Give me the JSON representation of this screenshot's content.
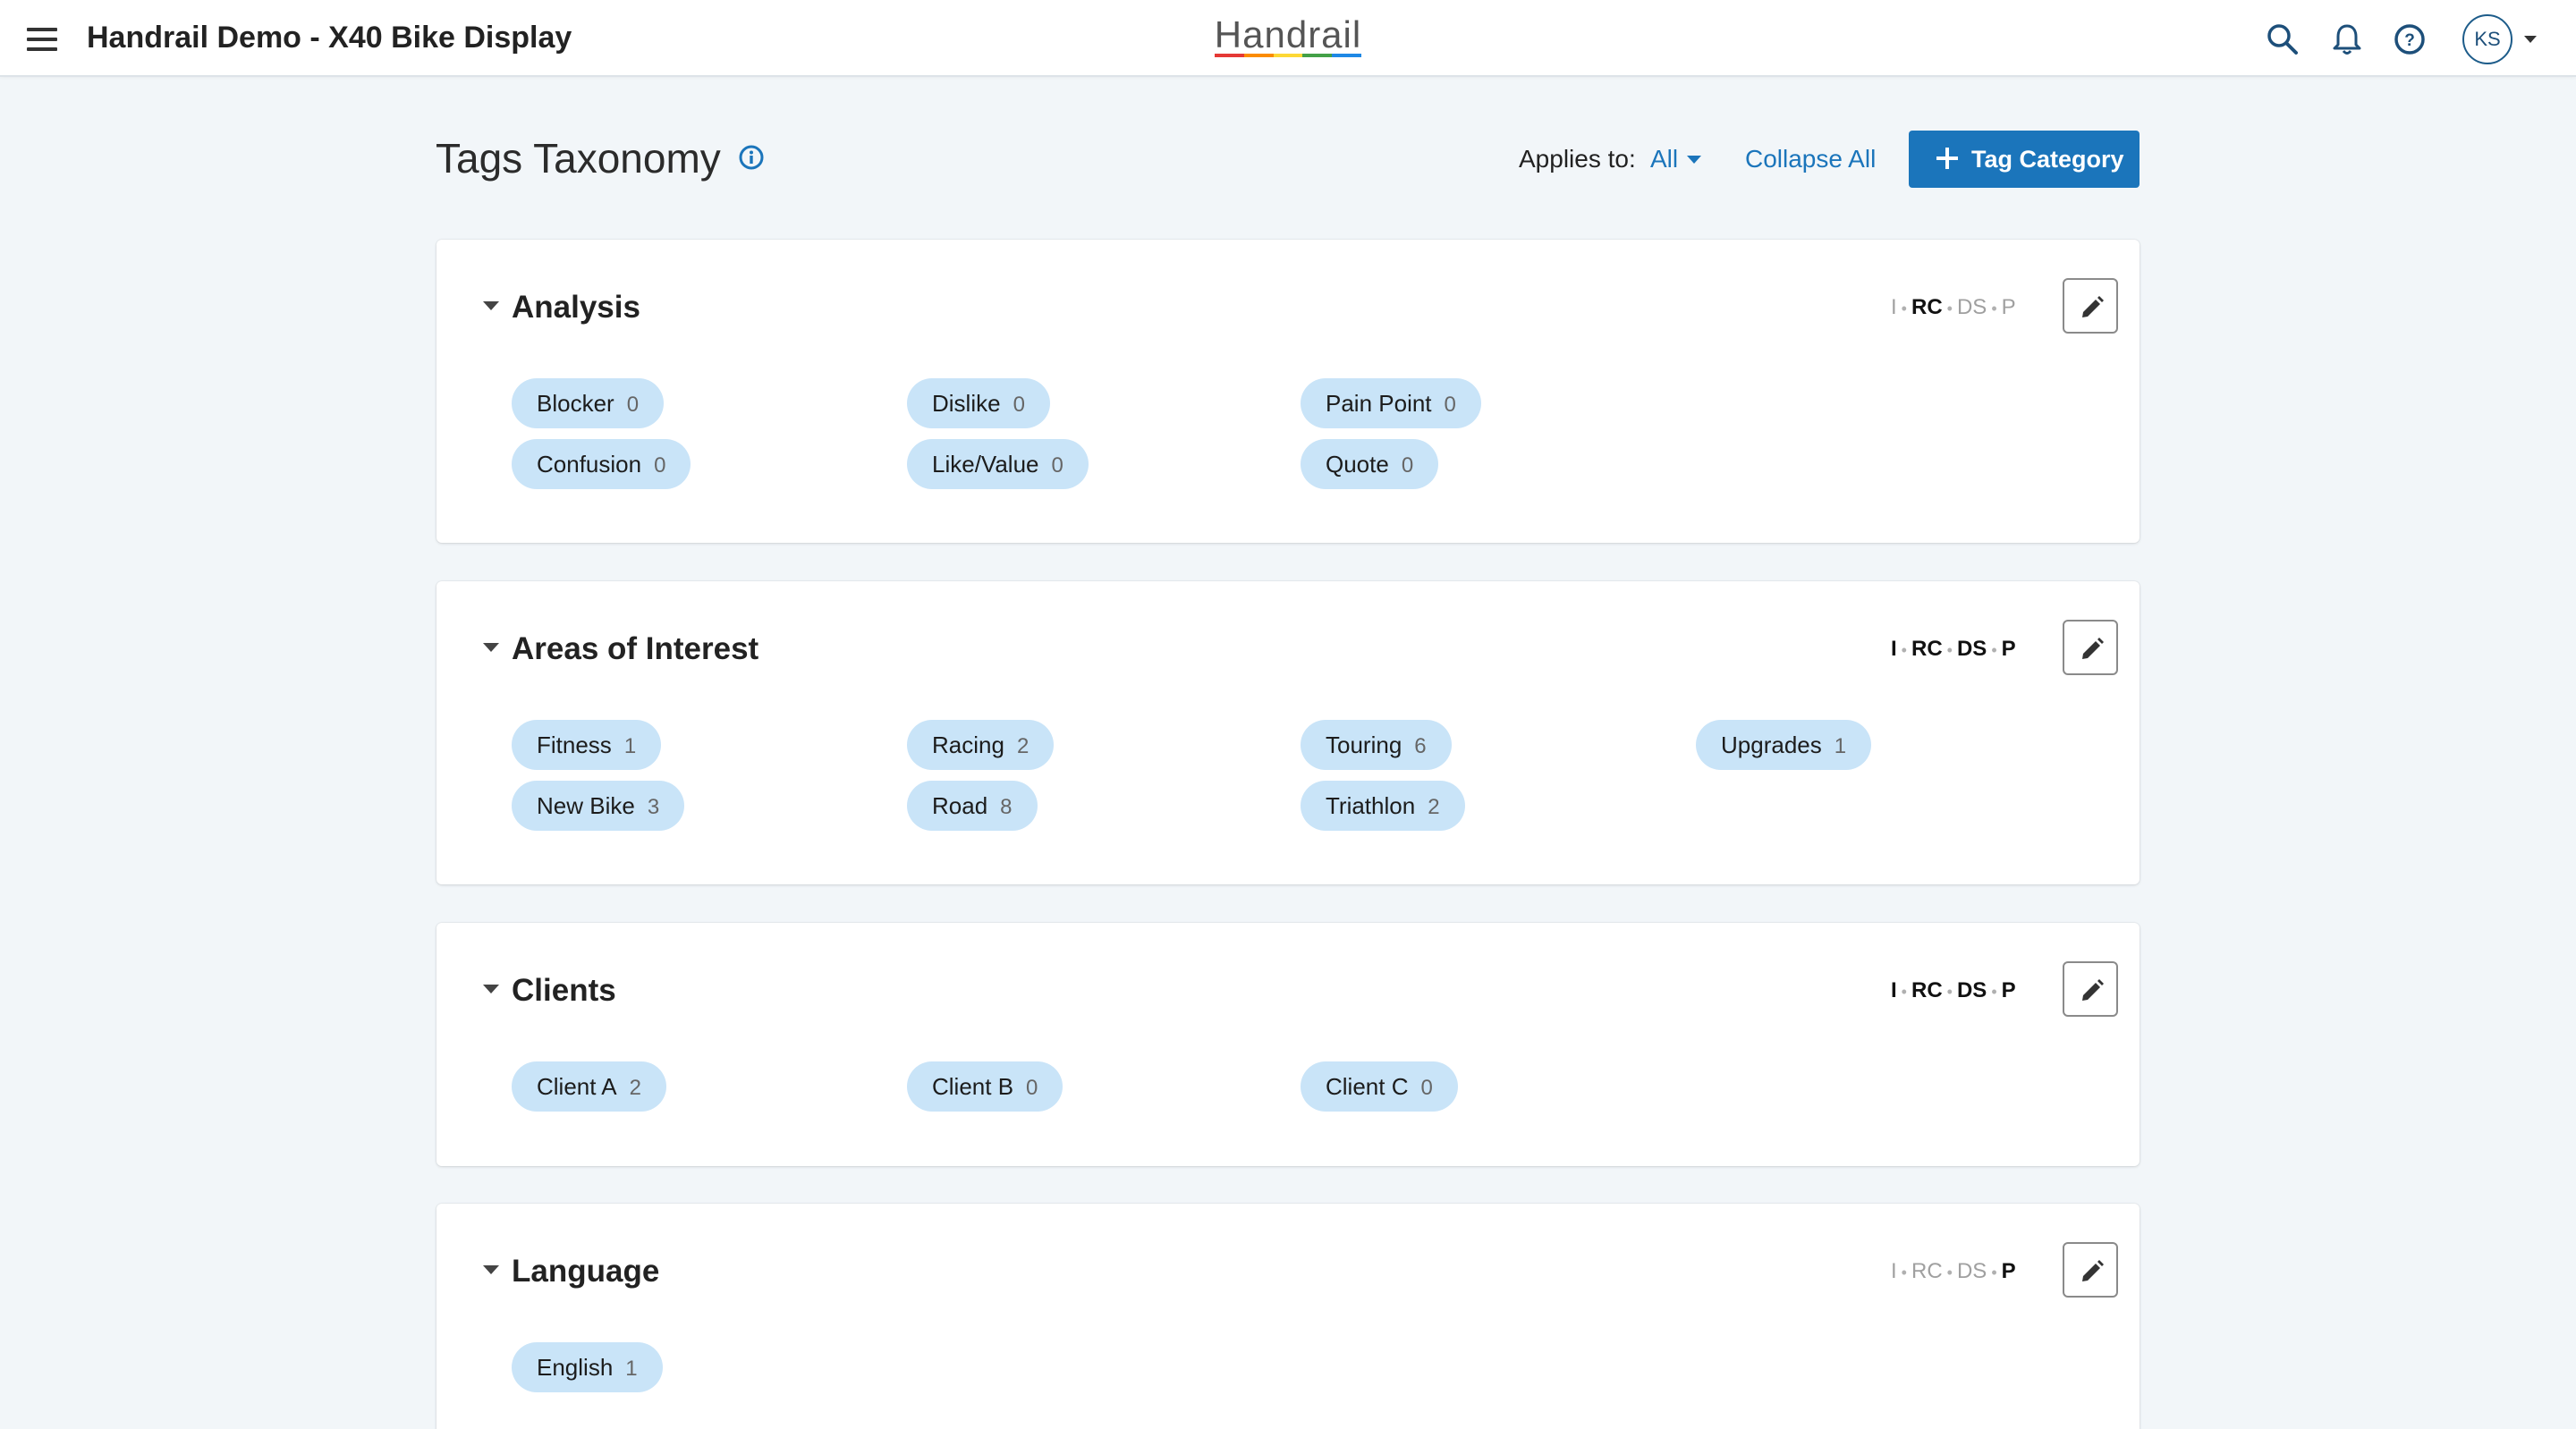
{
  "header": {
    "app_title": "Handrail Demo - X40 Bike Display",
    "logo_text": "Handrail",
    "avatar_initials": "KS",
    "icons": [
      "search-icon",
      "bell-icon",
      "help-icon"
    ]
  },
  "page": {
    "title": "Tags Taxonomy",
    "applies_label": "Applies to:",
    "applies_value": "All",
    "collapse_all": "Collapse All",
    "add_button": "Tag Category"
  },
  "scope_labels": [
    "I",
    "RC",
    "DS",
    "P"
  ],
  "colors": {
    "accent": "#1b75bb",
    "tag_bg": "#c9e4f8",
    "logo_stripes": [
      "#e53935",
      "#fb8c00",
      "#fdd835",
      "#43a047",
      "#1e88e5"
    ]
  },
  "categories": [
    {
      "name": "Analysis",
      "scope": {
        "I": false,
        "RC": true,
        "DS": false,
        "P": false
      },
      "tags": [
        {
          "label": "Blocker",
          "count": "0"
        },
        {
          "label": "Dislike",
          "count": "0"
        },
        {
          "label": "Pain Point",
          "count": "0"
        },
        {
          "label": "Confusion",
          "count": "0"
        },
        {
          "label": "Like/Value",
          "count": "0"
        },
        {
          "label": "Quote",
          "count": "0"
        }
      ]
    },
    {
      "name": "Areas of Interest",
      "scope": {
        "I": true,
        "RC": true,
        "DS": true,
        "P": true
      },
      "tags": [
        {
          "label": "Fitness",
          "count": "1"
        },
        {
          "label": "Racing",
          "count": "2"
        },
        {
          "label": "Touring",
          "count": "6"
        },
        {
          "label": "Upgrades",
          "count": "1"
        },
        {
          "label": "New Bike",
          "count": "3"
        },
        {
          "label": "Road",
          "count": "8"
        },
        {
          "label": "Triathlon",
          "count": "2"
        }
      ]
    },
    {
      "name": "Clients",
      "scope": {
        "I": true,
        "RC": true,
        "DS": true,
        "P": true
      },
      "tags": [
        {
          "label": "Client A",
          "count": "2"
        },
        {
          "label": "Client B",
          "count": "0"
        },
        {
          "label": "Client C",
          "count": "0"
        }
      ]
    },
    {
      "name": "Language",
      "scope": {
        "I": false,
        "RC": false,
        "DS": false,
        "P": true
      },
      "tags": [
        {
          "label": "English",
          "count": "1"
        }
      ]
    }
  ]
}
